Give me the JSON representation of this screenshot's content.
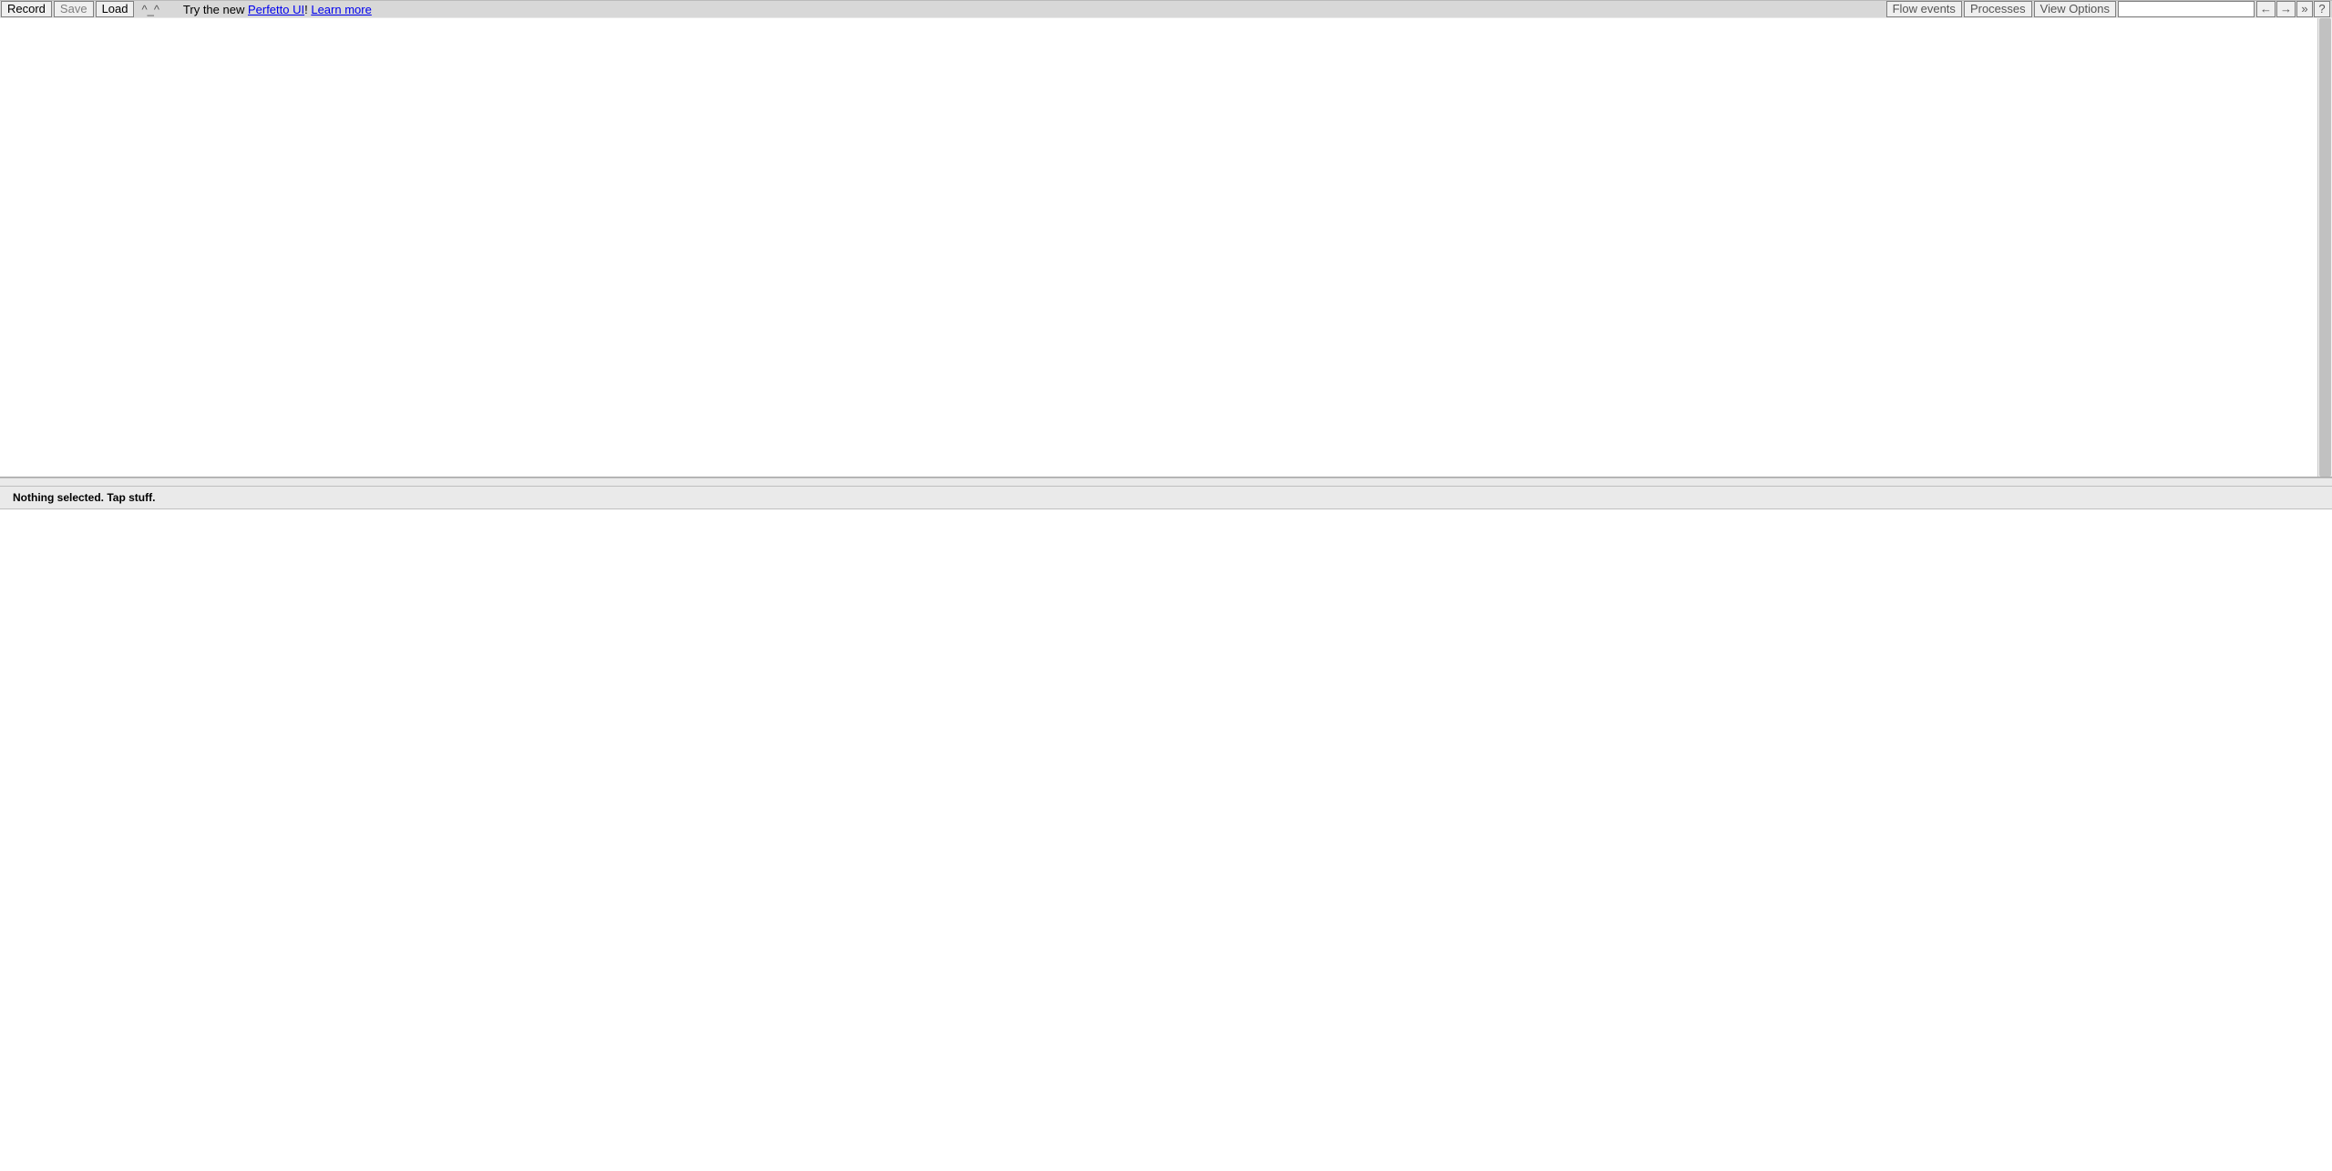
{
  "toolbar": {
    "record_label": "Record",
    "save_label": "Save",
    "load_label": "Load",
    "status_face": "^_^",
    "promo_prefix": "Try the new ",
    "promo_link_label": "Perfetto UI",
    "promo_middle": "! ",
    "learn_more_label": "Learn more",
    "flow_events_label": "Flow events",
    "processes_label": "Processes",
    "view_options_label": "View Options",
    "search_value": "",
    "prev_arrow": "←",
    "next_arrow": "→",
    "overflow_symbol": "»",
    "help_symbol": "?"
  },
  "selection": {
    "empty_message": "Nothing selected. Tap stuff."
  }
}
